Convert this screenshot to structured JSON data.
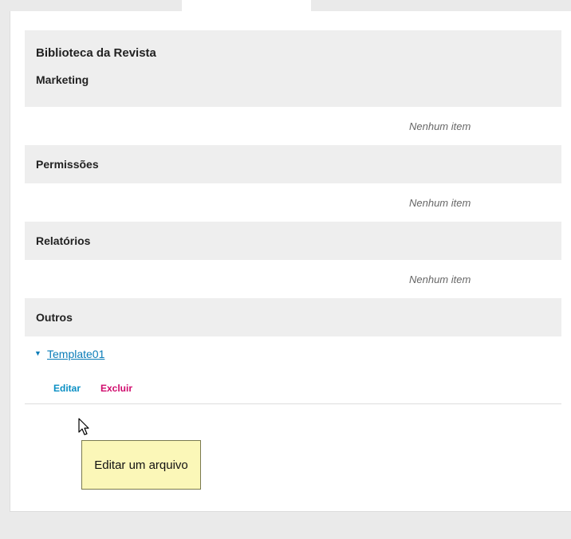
{
  "library": {
    "title": "Biblioteca da Revista"
  },
  "categories": [
    {
      "title": "Marketing",
      "empty_text": "Nenhum item"
    },
    {
      "title": "Permissões",
      "empty_text": "Nenhum item"
    },
    {
      "title": "Relatórios",
      "empty_text": "Nenhum item"
    },
    {
      "title": "Outros"
    }
  ],
  "files": [
    {
      "name": "Template01",
      "expander": "▼",
      "actions": {
        "edit": "Editar",
        "delete": "Excluir"
      }
    }
  ],
  "tooltip": {
    "text": "Editar um arquivo"
  },
  "colors": {
    "link": "#0a7cb8",
    "edit": "#0a8fc4",
    "delete": "#d00a6c",
    "tooltip_bg": "#fbf7b8",
    "header_bg": "#eeeeee"
  },
  "icons": {
    "cursor": "mouse-pointer-icon",
    "expander": "triangle-down-icon"
  }
}
